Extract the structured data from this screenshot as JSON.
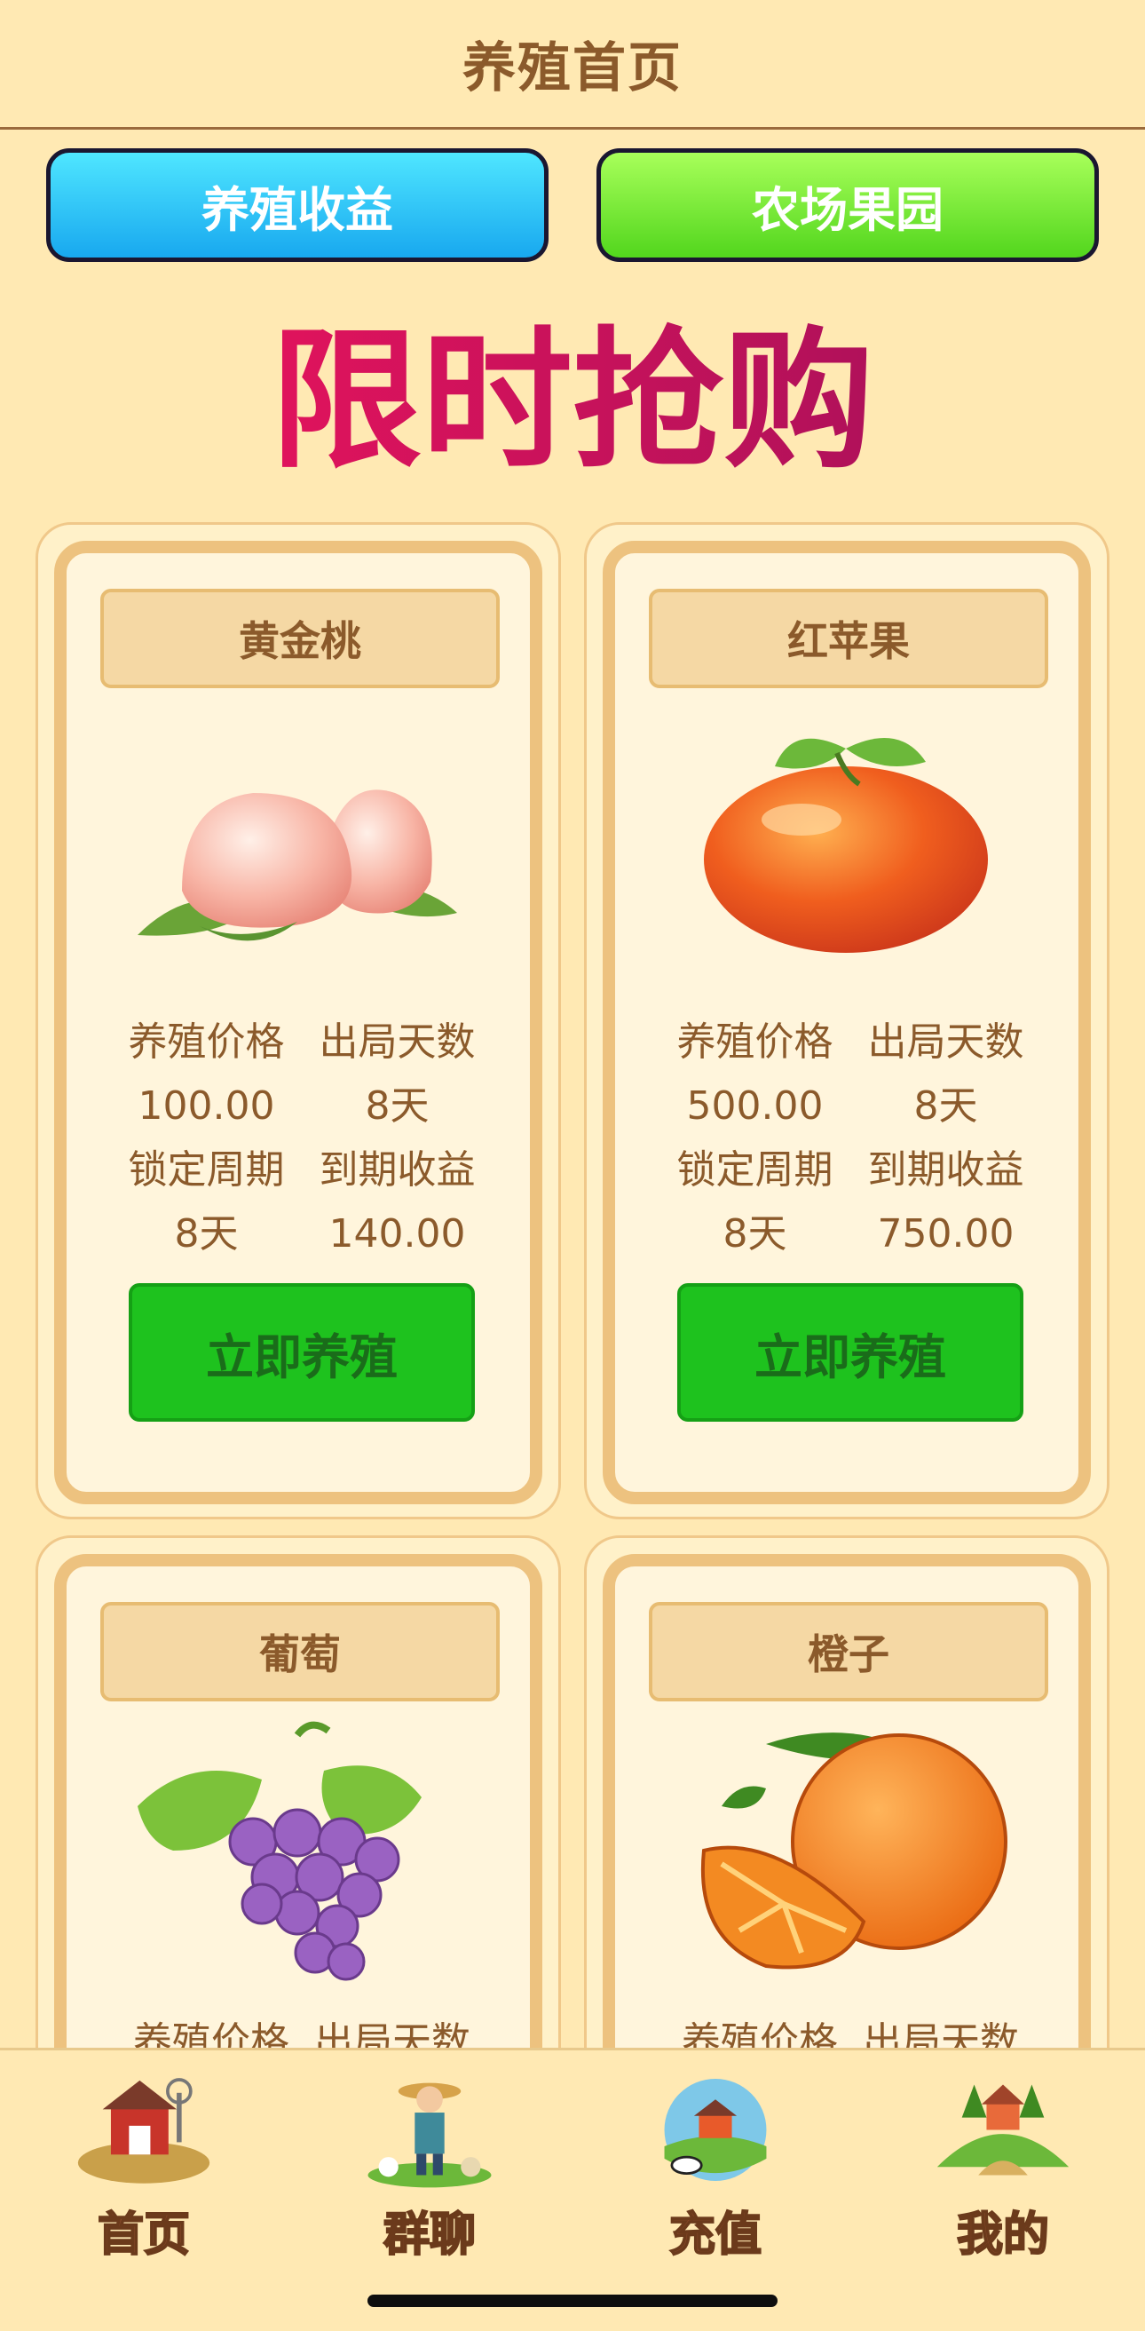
{
  "header": {
    "title": "养殖首页"
  },
  "top_buttons": {
    "left": "养殖收益",
    "right": "农场果园"
  },
  "banner": {
    "text": "限时抢购"
  },
  "labels": {
    "price": "养殖价格",
    "days": "出局天数",
    "lock": "锁定周期",
    "income": "到期收益",
    "buy": "立即养殖"
  },
  "products": [
    {
      "name": "黄金桃",
      "price": "100.00",
      "days": "8天",
      "lock": "8天",
      "income": "140.00"
    },
    {
      "name": "红苹果",
      "price": "500.00",
      "days": "8天",
      "lock": "8天",
      "income": "750.00"
    },
    {
      "name": "葡萄"
    },
    {
      "name": "橙子"
    }
  ],
  "partial_row_text": "养殖价格  出局天数",
  "nav": {
    "items": [
      {
        "label": "首页",
        "icon": "barn-icon"
      },
      {
        "label": "群聊",
        "icon": "farmer-icon"
      },
      {
        "label": "充值",
        "icon": "farm-globe-icon"
      },
      {
        "label": "我的",
        "icon": "house-hill-icon"
      }
    ]
  },
  "colors": {
    "background": "#ffe9b3",
    "brown_text": "#8b5a2b",
    "cyan_button": "#18a8ef",
    "green_button": "#52d61d",
    "buy_button": "#1ec21e",
    "banner_pink": "#e0135c"
  }
}
